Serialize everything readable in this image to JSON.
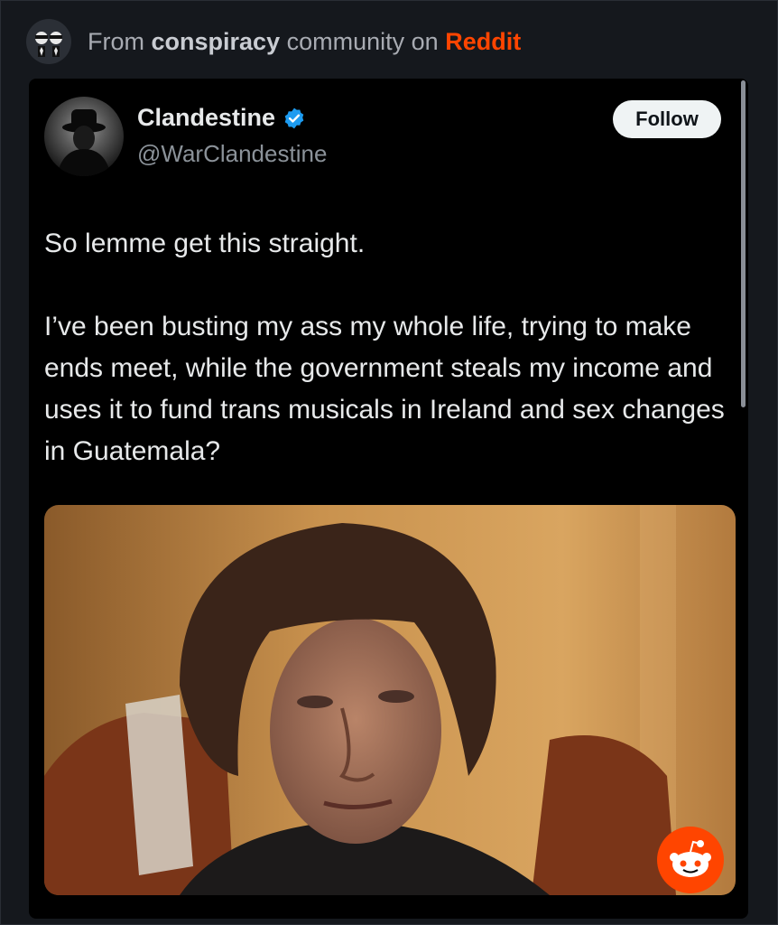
{
  "header": {
    "from_label": "From",
    "community": "conspiracy",
    "middle_label": "community on",
    "platform": "Reddit",
    "avatar_icon": "community-avatar-icon"
  },
  "tweet": {
    "author_name": "Clandestine",
    "handle": "@WarClandestine",
    "verified_icon": "verified-badge-icon",
    "follow_label": "Follow",
    "text": "So lemme get this straight.\n\nI’ve been busting my ass my whole life, trying to make ends meet, while the government steals my income and uses it to fund trans musicals in Ireland and sex changes in Guatemala?"
  },
  "colors": {
    "accent_reddit": "#ff4500",
    "verified_blue": "#1d9bf0",
    "card_bg": "#000000",
    "page_bg": "#15181d"
  },
  "media": {
    "icon": "reddit-logo-icon"
  }
}
